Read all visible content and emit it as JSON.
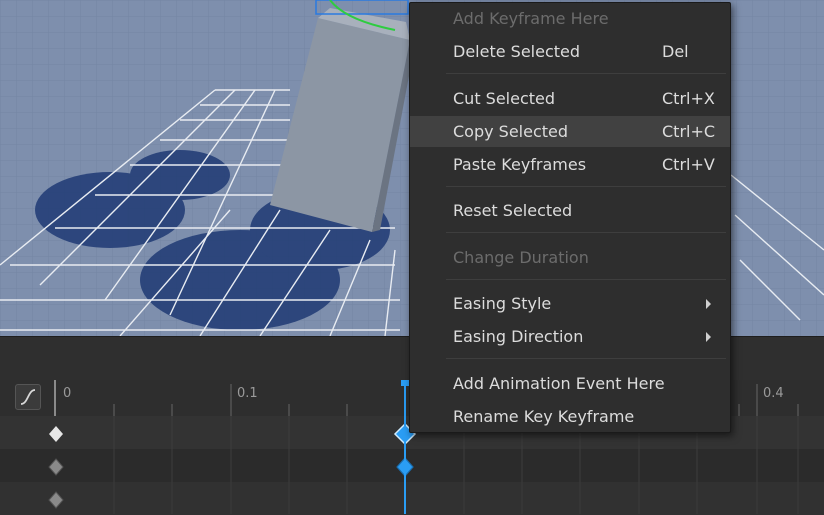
{
  "timeline": {
    "ticks": [
      "0",
      "0.1",
      "0.4"
    ]
  },
  "context_menu": {
    "items": [
      {
        "label": "Add Keyframe Here",
        "shortcut": "",
        "disabled": true
      },
      {
        "label": "Delete Selected",
        "shortcut": "Del"
      },
      {
        "label": "Cut Selected",
        "shortcut": "Ctrl+X"
      },
      {
        "label": "Copy Selected",
        "shortcut": "Ctrl+C",
        "hovered": true
      },
      {
        "label": "Paste Keyframes",
        "shortcut": "Ctrl+V"
      },
      {
        "label": "Reset Selected",
        "shortcut": ""
      },
      {
        "label": "Change Duration",
        "shortcut": "",
        "disabled": true
      },
      {
        "label": "Easing Style",
        "shortcut": "",
        "submenu": true
      },
      {
        "label": "Easing Direction",
        "shortcut": "",
        "submenu": true
      },
      {
        "label": "Add Animation Event Here",
        "shortcut": ""
      },
      {
        "label": "Rename Key Keyframe",
        "shortcut": ""
      }
    ]
  },
  "colors": {
    "accent": "#2a9df4",
    "menu_bg": "#2e2e2e",
    "viewport_bg": "#7d8fae"
  }
}
